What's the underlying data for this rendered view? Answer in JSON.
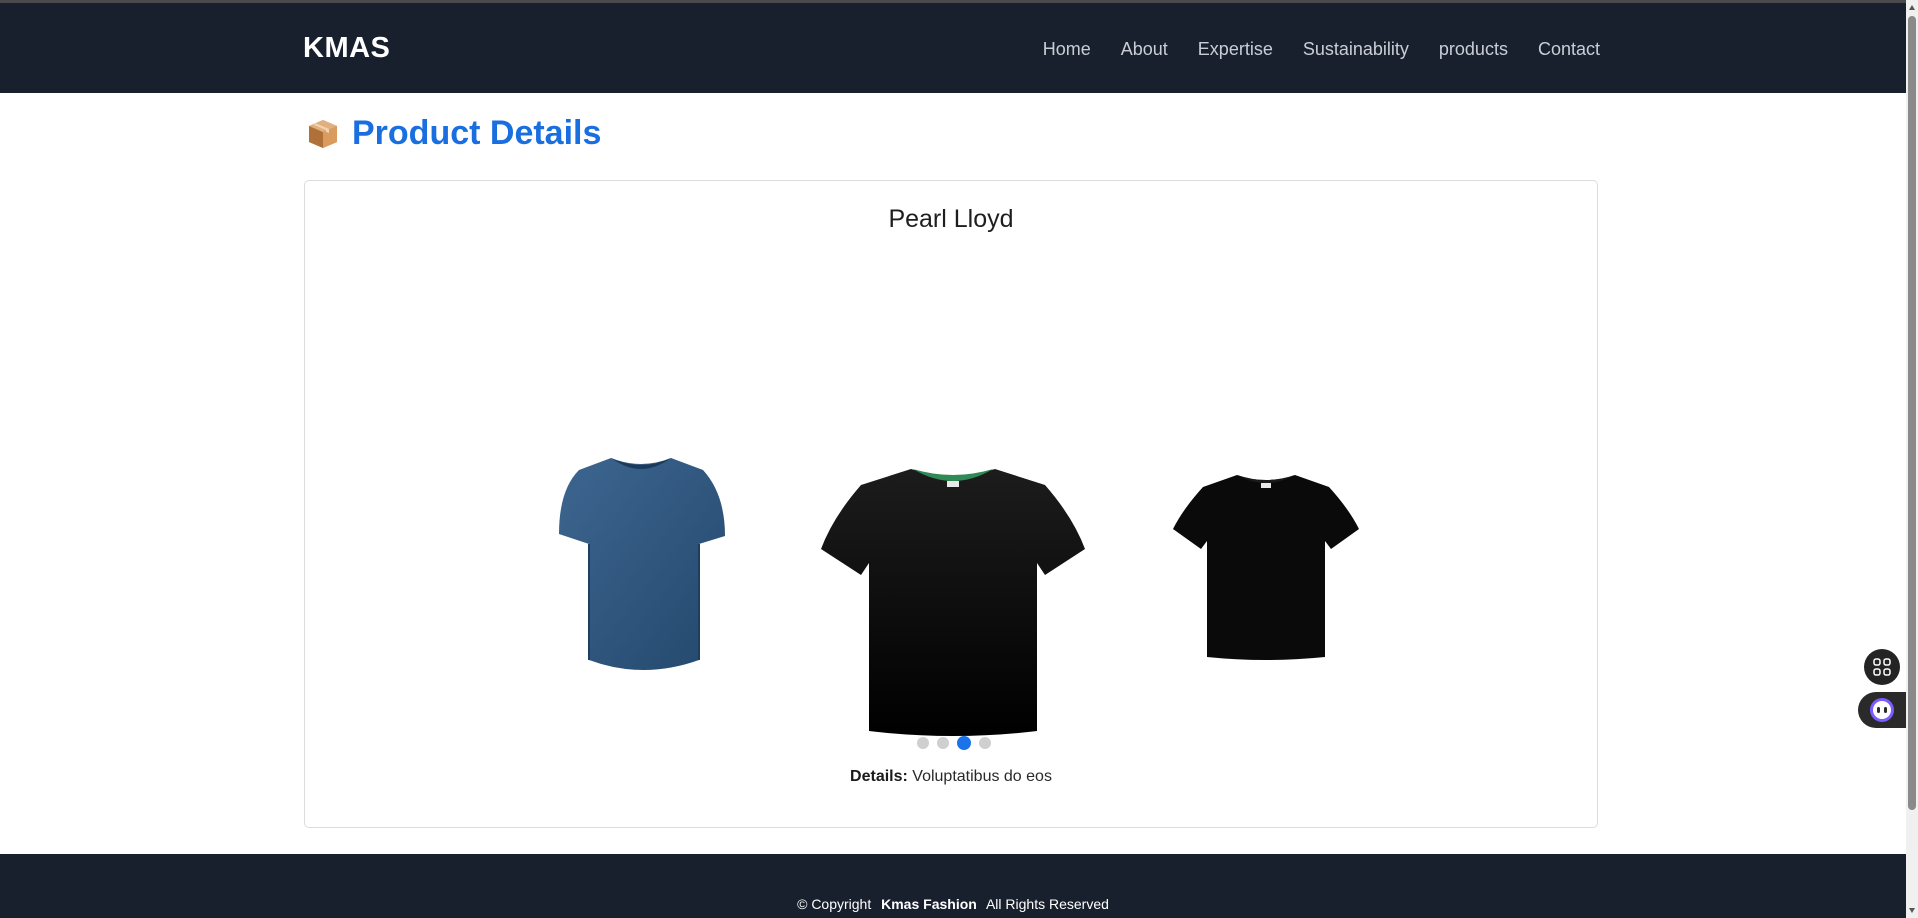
{
  "header": {
    "brand": "KMAS",
    "nav": [
      "Home",
      "About",
      "Expertise",
      "Sustainability",
      "products",
      "Contact"
    ]
  },
  "page": {
    "icon": "package-icon",
    "title": "Product Details"
  },
  "product": {
    "name": "Pearl Lloyd",
    "images": [
      "blue-tshirt",
      "black-tshirt",
      "black-tshirt"
    ],
    "carousel_total": 4,
    "carousel_active": 3,
    "details_label": "Details:",
    "details_value": "Voluptatibus do eos"
  },
  "footer": {
    "copyright_prefix": "© Copyright",
    "company": "Kmas Fashion",
    "rights": "All Rights Reserved"
  },
  "colors": {
    "navbar": "#18202e",
    "accent": "#1a6fe0",
    "dot_active": "#1a73e8"
  }
}
